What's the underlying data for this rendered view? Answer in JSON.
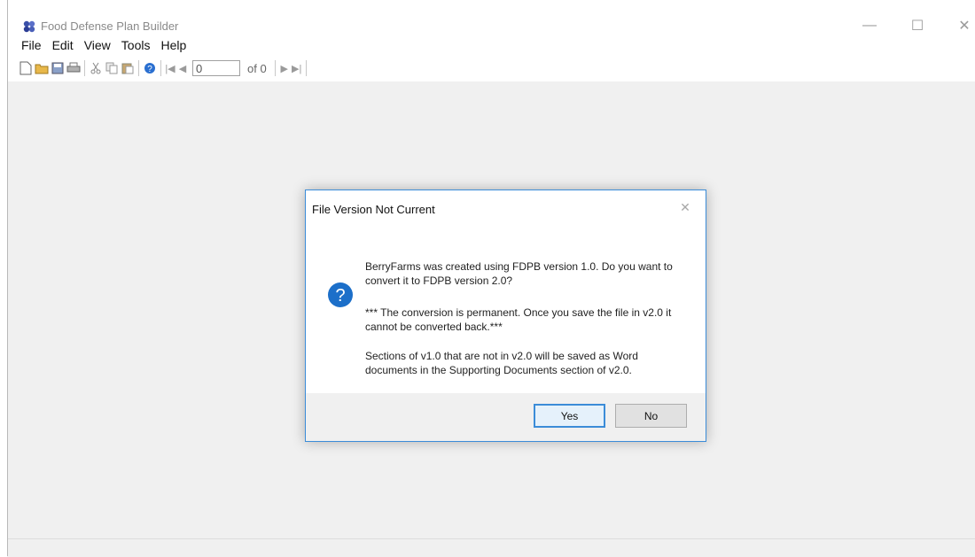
{
  "window": {
    "title": "Food Defense Plan Builder",
    "controls": {
      "minimize": "—",
      "maximize": "☐",
      "close": "✕"
    }
  },
  "menu": [
    "File",
    "Edit",
    "View",
    "Tools",
    "Help"
  ],
  "toolbar": {
    "page_value": "0",
    "of_label": "of 0",
    "buttons": [
      "new-icon",
      "open-icon",
      "save-icon",
      "print-icon",
      "cut-icon",
      "copy-icon",
      "paste-icon",
      "help-icon",
      "first-page-icon",
      "prev-page-icon",
      "next-page-icon",
      "last-page-icon"
    ]
  },
  "dialog": {
    "title": "File Version Not Current",
    "close_glyph": "✕",
    "message_1": "BerryFarms was created using FDPB version 1.0.  Do you want to convert it to FDPB version 2.0?",
    "message_2": "*** The conversion is permanent.  Once you save the file in v2.0 it cannot be converted back.***",
    "message_3": "Sections of v1.0 that are not in v2.0 will be saved as Word documents in the Supporting Documents section of v2.0.",
    "icon_glyph": "?",
    "yes_label": "Yes",
    "no_label": "No"
  },
  "colors": {
    "accent": "#3b8cd8",
    "question_icon": "#1c6fc9",
    "window_bg": "#f0f0f0"
  }
}
